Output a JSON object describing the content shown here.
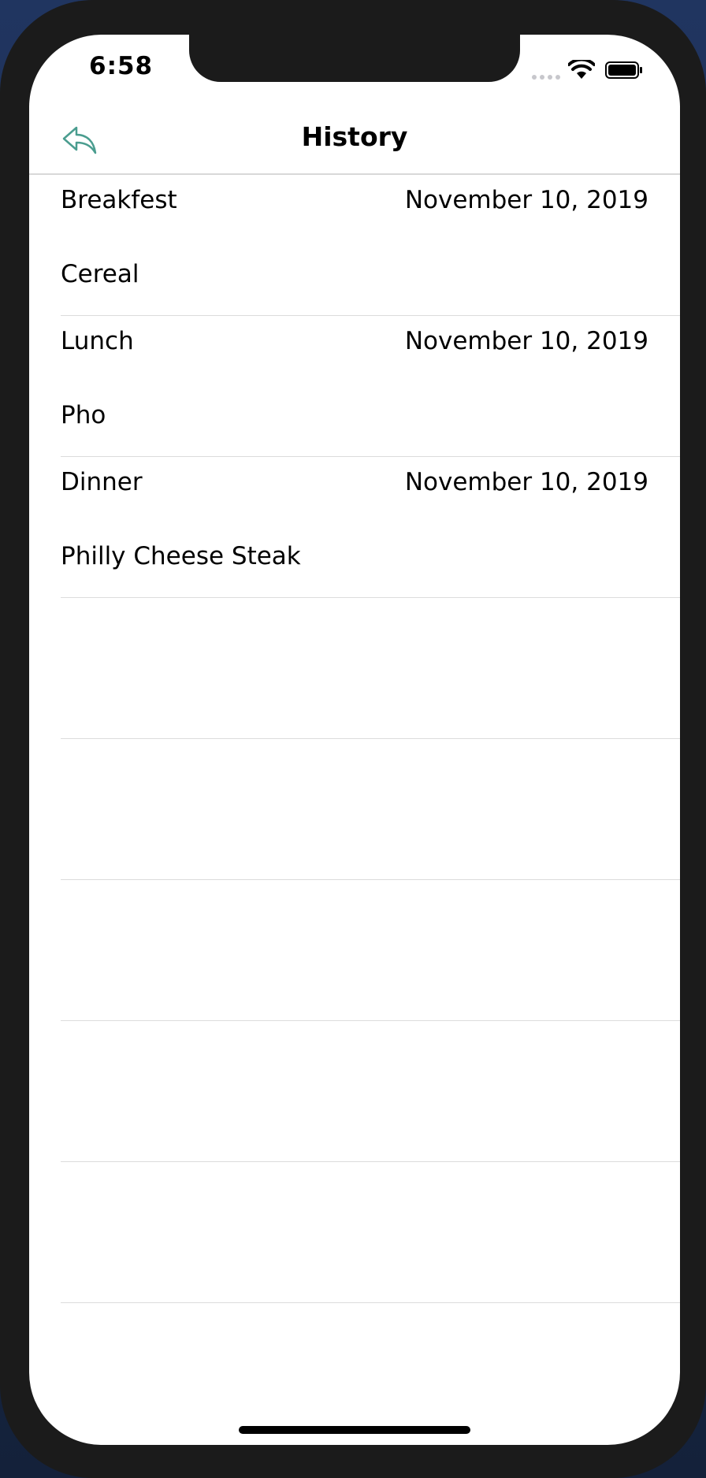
{
  "status_bar": {
    "time": "6:58"
  },
  "nav": {
    "title": "History",
    "back_icon": "reply-arrow-icon",
    "accent_color": "#4a9d8f"
  },
  "entries": [
    {
      "meal": "Breakfest",
      "date": "November 10, 2019",
      "food": "Cereal"
    },
    {
      "meal": "Lunch",
      "date": "November 10, 2019",
      "food": "Pho"
    },
    {
      "meal": "Dinner",
      "date": "November 10, 2019",
      "food": "Philly Cheese Steak"
    }
  ]
}
